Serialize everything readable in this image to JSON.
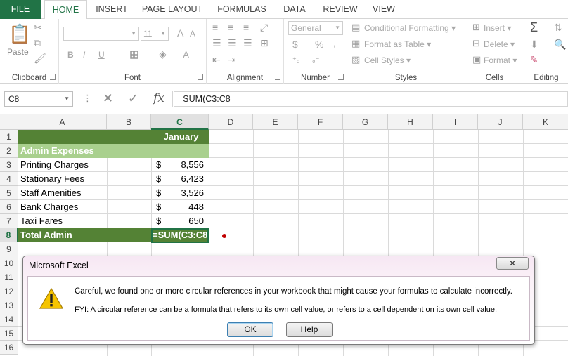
{
  "ribbon_tabs": [
    "FILE",
    "HOME",
    "INSERT",
    "PAGE LAYOUT",
    "FORMULAS",
    "DATA",
    "REVIEW",
    "VIEW"
  ],
  "active_tab": "HOME",
  "ribbon": {
    "clipboard": {
      "label": "Clipboard",
      "paste": "Paste"
    },
    "font": {
      "label": "Font",
      "font_size": "11",
      "bold": "B",
      "italic": "I",
      "underline": "U"
    },
    "alignment": {
      "label": "Alignment"
    },
    "number": {
      "label": "Number",
      "format": "General",
      "currency": "$",
      "percent": "%"
    },
    "styles": {
      "label": "Styles",
      "conditional": "Conditional Formatting",
      "format_table": "Format as Table",
      "cell_styles": "Cell Styles"
    },
    "cells": {
      "label": "Cells",
      "insert": "Insert",
      "delete": "Delete",
      "format": "Format"
    },
    "editing": {
      "label": "Editing",
      "sum": "Σ"
    }
  },
  "formula_bar": {
    "name_box": "C8",
    "formula": "=SUM(C3:C8",
    "fx": "fx"
  },
  "columns": [
    "A",
    "B",
    "C",
    "D",
    "E",
    "F",
    "G",
    "H",
    "I",
    "J",
    "K"
  ],
  "rows": [
    "1",
    "2",
    "3",
    "4",
    "5",
    "6",
    "7",
    "8",
    "9",
    "10",
    "11",
    "12",
    "13",
    "14",
    "15",
    "16"
  ],
  "sheet": {
    "header": "January",
    "section": "Admin Expenses",
    "items": [
      {
        "label": "Printing Charges",
        "currency": "$",
        "value": "8,556"
      },
      {
        "label": "Stationary Fees",
        "currency": "$",
        "value": "6,423"
      },
      {
        "label": "Staff Amenities",
        "currency": "$",
        "value": "3,526"
      },
      {
        "label": "Bank Charges",
        "currency": "$",
        "value": "448"
      },
      {
        "label": "Taxi Fares",
        "currency": "$",
        "value": "650"
      }
    ],
    "total_label": "Total Admin",
    "total_value": "=SUM(C3:C8"
  },
  "colors": {
    "excel_green": "#217346",
    "header_green": "#548235",
    "section_green": "#a9d08e"
  },
  "dialog": {
    "title": "Microsoft Excel",
    "close": "✕",
    "message": "Careful, we found one or more circular references in your workbook that might cause your formulas to calculate incorrectly.",
    "fyi": "FYI: A circular reference can be a formula that refers to its own cell value, or refers to a cell dependent on its own cell value.",
    "ok": "OK",
    "help": "Help"
  }
}
